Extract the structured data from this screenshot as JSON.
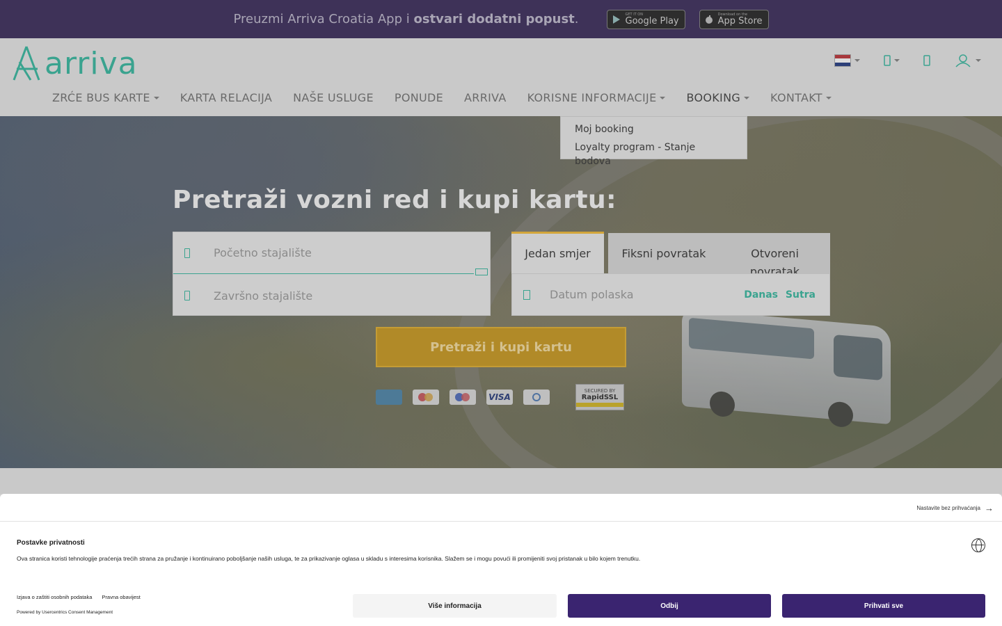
{
  "promo": {
    "text_prefix": "Preuzmi Arriva Croatia App i ",
    "text_bold": "ostvari dodatni popust",
    "text_suffix": ".",
    "google_small": "GET IT ON",
    "google_big": "Google Play",
    "apple_small": "Download on the",
    "apple_big": "App Store"
  },
  "header": {
    "logo_text": "arriva",
    "nav": [
      "ZRĆE BUS KARTE",
      "KARTA RELACIJA",
      "NAŠE USLUGE",
      "PONUDE",
      "ARRIVA",
      "KORISNE INFORMACIJE",
      "BOOKING",
      "KONTAKT"
    ],
    "language_flag": "Croatian flag"
  },
  "dropdown": {
    "items": [
      "Moj booking",
      "Loyalty program - Stanje bodova"
    ]
  },
  "hero": {
    "title": "Pretraži vozni red i kupi kartu:",
    "from_placeholder": "Početno stajalište",
    "to_placeholder": "Završno stajalište",
    "tabs": [
      "Jedan smjer",
      "Fiksni povratak",
      "Otvoreni",
      "povratak"
    ],
    "date_placeholder": "Datum polaska",
    "quick_today": "Danas",
    "quick_tomorrow": "Sutra",
    "search_button": "Pretraži i kupi kartu",
    "payment_cards": [
      "AMERICAN EXPRESS",
      "Mastercard",
      "Maestro",
      "VISA",
      "Diners Club"
    ],
    "ssl_badge": {
      "line1": "SECURED BY",
      "line2": "RapidSSL"
    }
  },
  "consent": {
    "continue_without": "Nastavite bez prihvaćanja",
    "title": "Postavke privatnosti",
    "body": "Ova stranica koristi tehnologije praćenja trećih strana za pružanje i kontinuirano poboljšanje naših usluga, te za prikazivanje oglasa u skladu s interesima korisnika. Slažem se i mogu povući ili promijeniti svoj pristanak u bilo kojem trenutku.",
    "link_privacy": "Izjava o zaštiti osobnih podataka",
    "link_legal": "Pravna obavijest",
    "powered": "Powered by Usercentrics Consent Management",
    "btn_more": "Više informacija",
    "btn_deny": "Odbij",
    "btn_accept": "Prihvati sve"
  },
  "colors": {
    "promo_bg": "#3e3258",
    "brand_teal": "#3aa38f",
    "search_button": "#b18a28",
    "consent_button": "#3a2470"
  }
}
